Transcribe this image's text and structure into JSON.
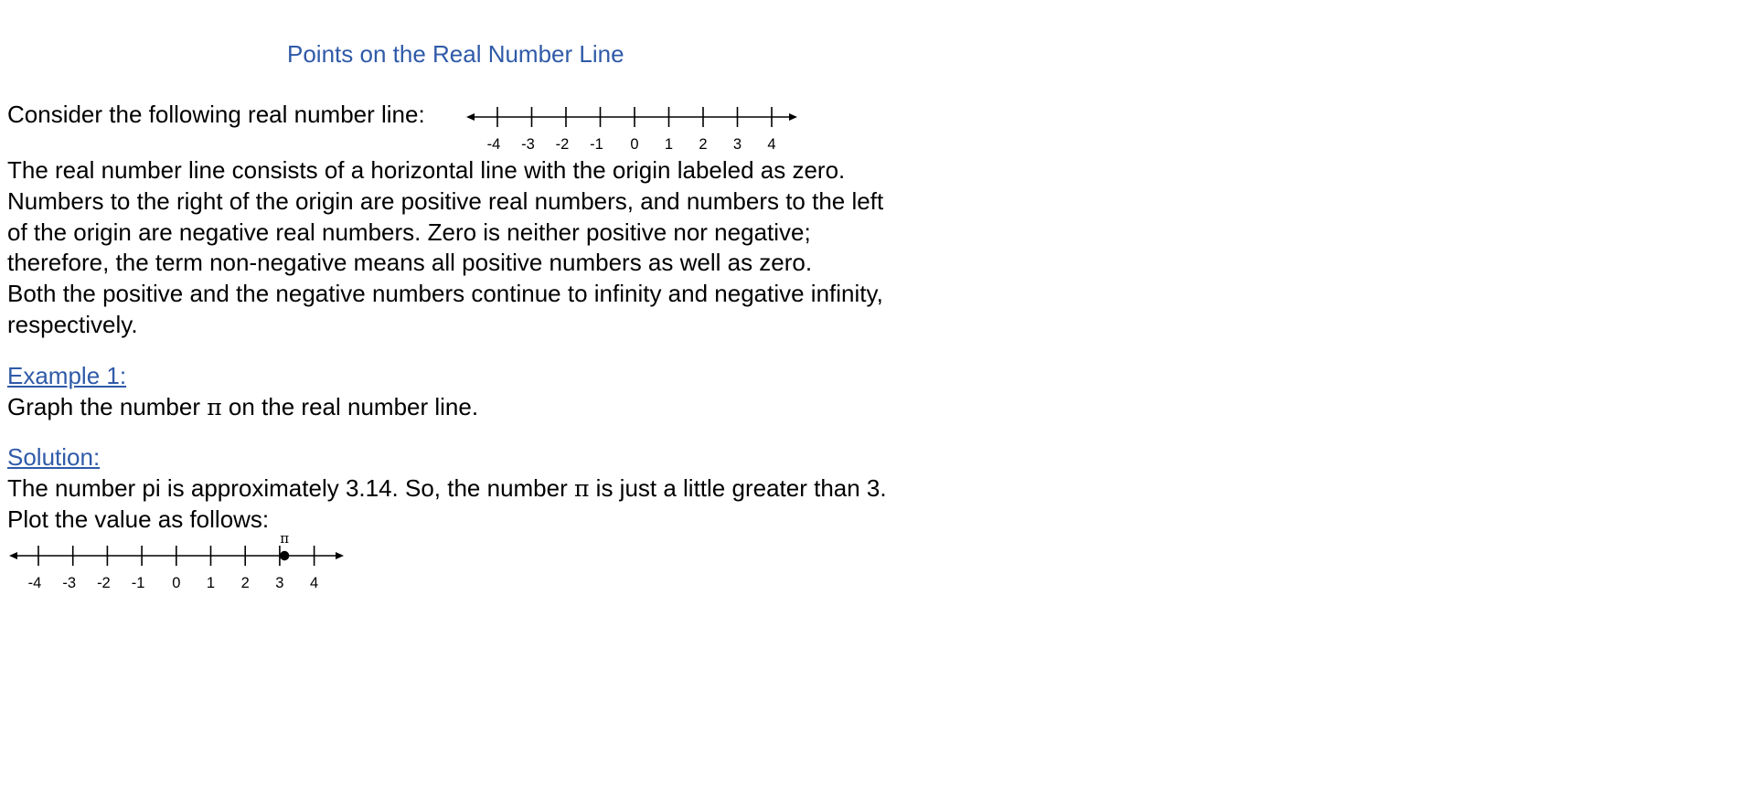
{
  "title": "Points on the Real Number Line",
  "intro_text": "Consider the following real number line:",
  "number_line_ticks": [
    "-4",
    "-3",
    "-2",
    "-1",
    "0",
    "1",
    "2",
    "3",
    "4"
  ],
  "paragraph": [
    "The real number line consists of a horizontal line with the origin labeled as zero.",
    "Numbers to the right of the origin are positive real numbers, and numbers to the left",
    "of the origin are negative real numbers.  Zero is neither positive nor negative;",
    "therefore, the term non-negative means all positive numbers as well as zero.",
    "Both the positive and the negative numbers continue to infinity and negative infinity,",
    "respectively."
  ],
  "example": {
    "heading": "Example 1:",
    "prompt_before": "Graph the number ",
    "prompt_symbol": "π",
    "prompt_after": " on the real number line."
  },
  "solution": {
    "heading": "Solution:",
    "line1_before": "The number pi is approximately 3.14.  So, the number ",
    "line1_symbol": "π",
    "line1_after": " is just a little greater than 3.",
    "line2": "Plot the value as follows:",
    "plotted_point": {
      "label": "π",
      "value": 3.14
    }
  },
  "colors": {
    "heading": "#2f5aa8",
    "text": "#000000"
  }
}
